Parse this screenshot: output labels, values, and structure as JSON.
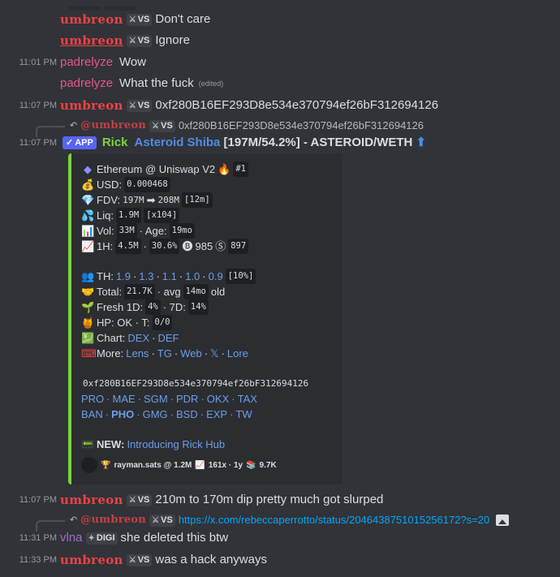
{
  "rows": {
    "r1": {
      "user": "umbreon",
      "tag": "VS",
      "text": "Don't care"
    },
    "r2": {
      "user": "umbreon",
      "tag": "VS",
      "text": "Ignore"
    },
    "r3": {
      "time": "11:01 PM",
      "user": "padrelyze",
      "text": "Wow"
    },
    "r4": {
      "user": "padrelyze",
      "text": "What the fuck",
      "edited": "(edited)"
    },
    "r5": {
      "time": "11:07 PM",
      "user": "umbreon",
      "tag": "VS",
      "text": "0xf280B16EF293D8e534e370794ef26bF312694126"
    },
    "r6": {
      "reply_user": "@umbreon",
      "tag": "VS",
      "text": "0xf280B16EF293D8e534e370794ef26bF312694126"
    },
    "r7": {
      "time": "11:07 PM",
      "app_badge": "APP",
      "user": "Rick",
      "title": "Asteroid Shiba",
      "rest": " [197M/54.2%] - ASTEROID/WETH",
      "arrow": "⬆"
    },
    "r8": {
      "time": "11:07 PM",
      "user": "umbreon",
      "tag": "VS",
      "text": "210m to 170m dip pretty much got slurped"
    },
    "r9": {
      "reply_user": "@umbreon",
      "tag": "VS",
      "link": "https://x.com/rebeccaperrotto/status/2046438751015256172?s=20"
    },
    "r10": {
      "time": "11:31 PM",
      "user": "vlna",
      "tag": "DIGI",
      "text": "she deleted this btw"
    },
    "r11": {
      "time": "11:33 PM",
      "user": "umbreon",
      "tag": "VS",
      "text": "was a hack anyways"
    }
  },
  "embed": {
    "chain": "Ethereum @ Uniswap V2",
    "rank": "#1",
    "usd_label": "USD:",
    "usd": "0.000468",
    "fdv_label": "FDV:",
    "fdv_from": "197M",
    "fdv_to": "208M",
    "fdv_x": "[12m]",
    "liq_label": "Liq:",
    "liq": "1.9M",
    "liq_x": "[x104]",
    "vol_label": "Vol:",
    "vol": "33M",
    "age_label": "· Age:",
    "age": "19mo",
    "h1_label": "1H:",
    "h1_vol": "4.5M",
    "h1_pct": "30.6%",
    "h1_buys": "985",
    "h1_sells": "897",
    "th_label": "TH:",
    "th_vals": [
      "1.9",
      "1.3",
      "1.1",
      "1.0",
      "0.9"
    ],
    "th_x": "[10%]",
    "total_label": "Total:",
    "total": "21.7K",
    "avg_label": "· avg",
    "avg": "14mo",
    "avg_tail": "old",
    "fresh_label": "Fresh 1D:",
    "fresh1d": "4%",
    "fresh7_label": "· 7D:",
    "fresh7d": "14%",
    "hp_label": "HP: OK · T:",
    "hp_t": "0/0",
    "chart_label": "Chart:",
    "chart_links": [
      "DEX",
      "DEF"
    ],
    "more_label": "More:",
    "more_links": [
      "Lens",
      "TG",
      "Web",
      "𝕏",
      "Lore"
    ],
    "address": "0xf280B16EF293D8e534e370794ef26bF312694126",
    "links1": [
      "PRO",
      "MAE",
      "SGM",
      "PDR",
      "OKX",
      "TAX"
    ],
    "links2": [
      "BAN",
      "PHO",
      "GMG",
      "BSD",
      "EXP",
      "TW"
    ],
    "new_label": "NEW:",
    "new_text": "Introducing Rick Hub",
    "footer": {
      "name": "rayman.sats @ 1.2M",
      "stat1": "161x · 1y",
      "stat2": "9.7K"
    }
  }
}
